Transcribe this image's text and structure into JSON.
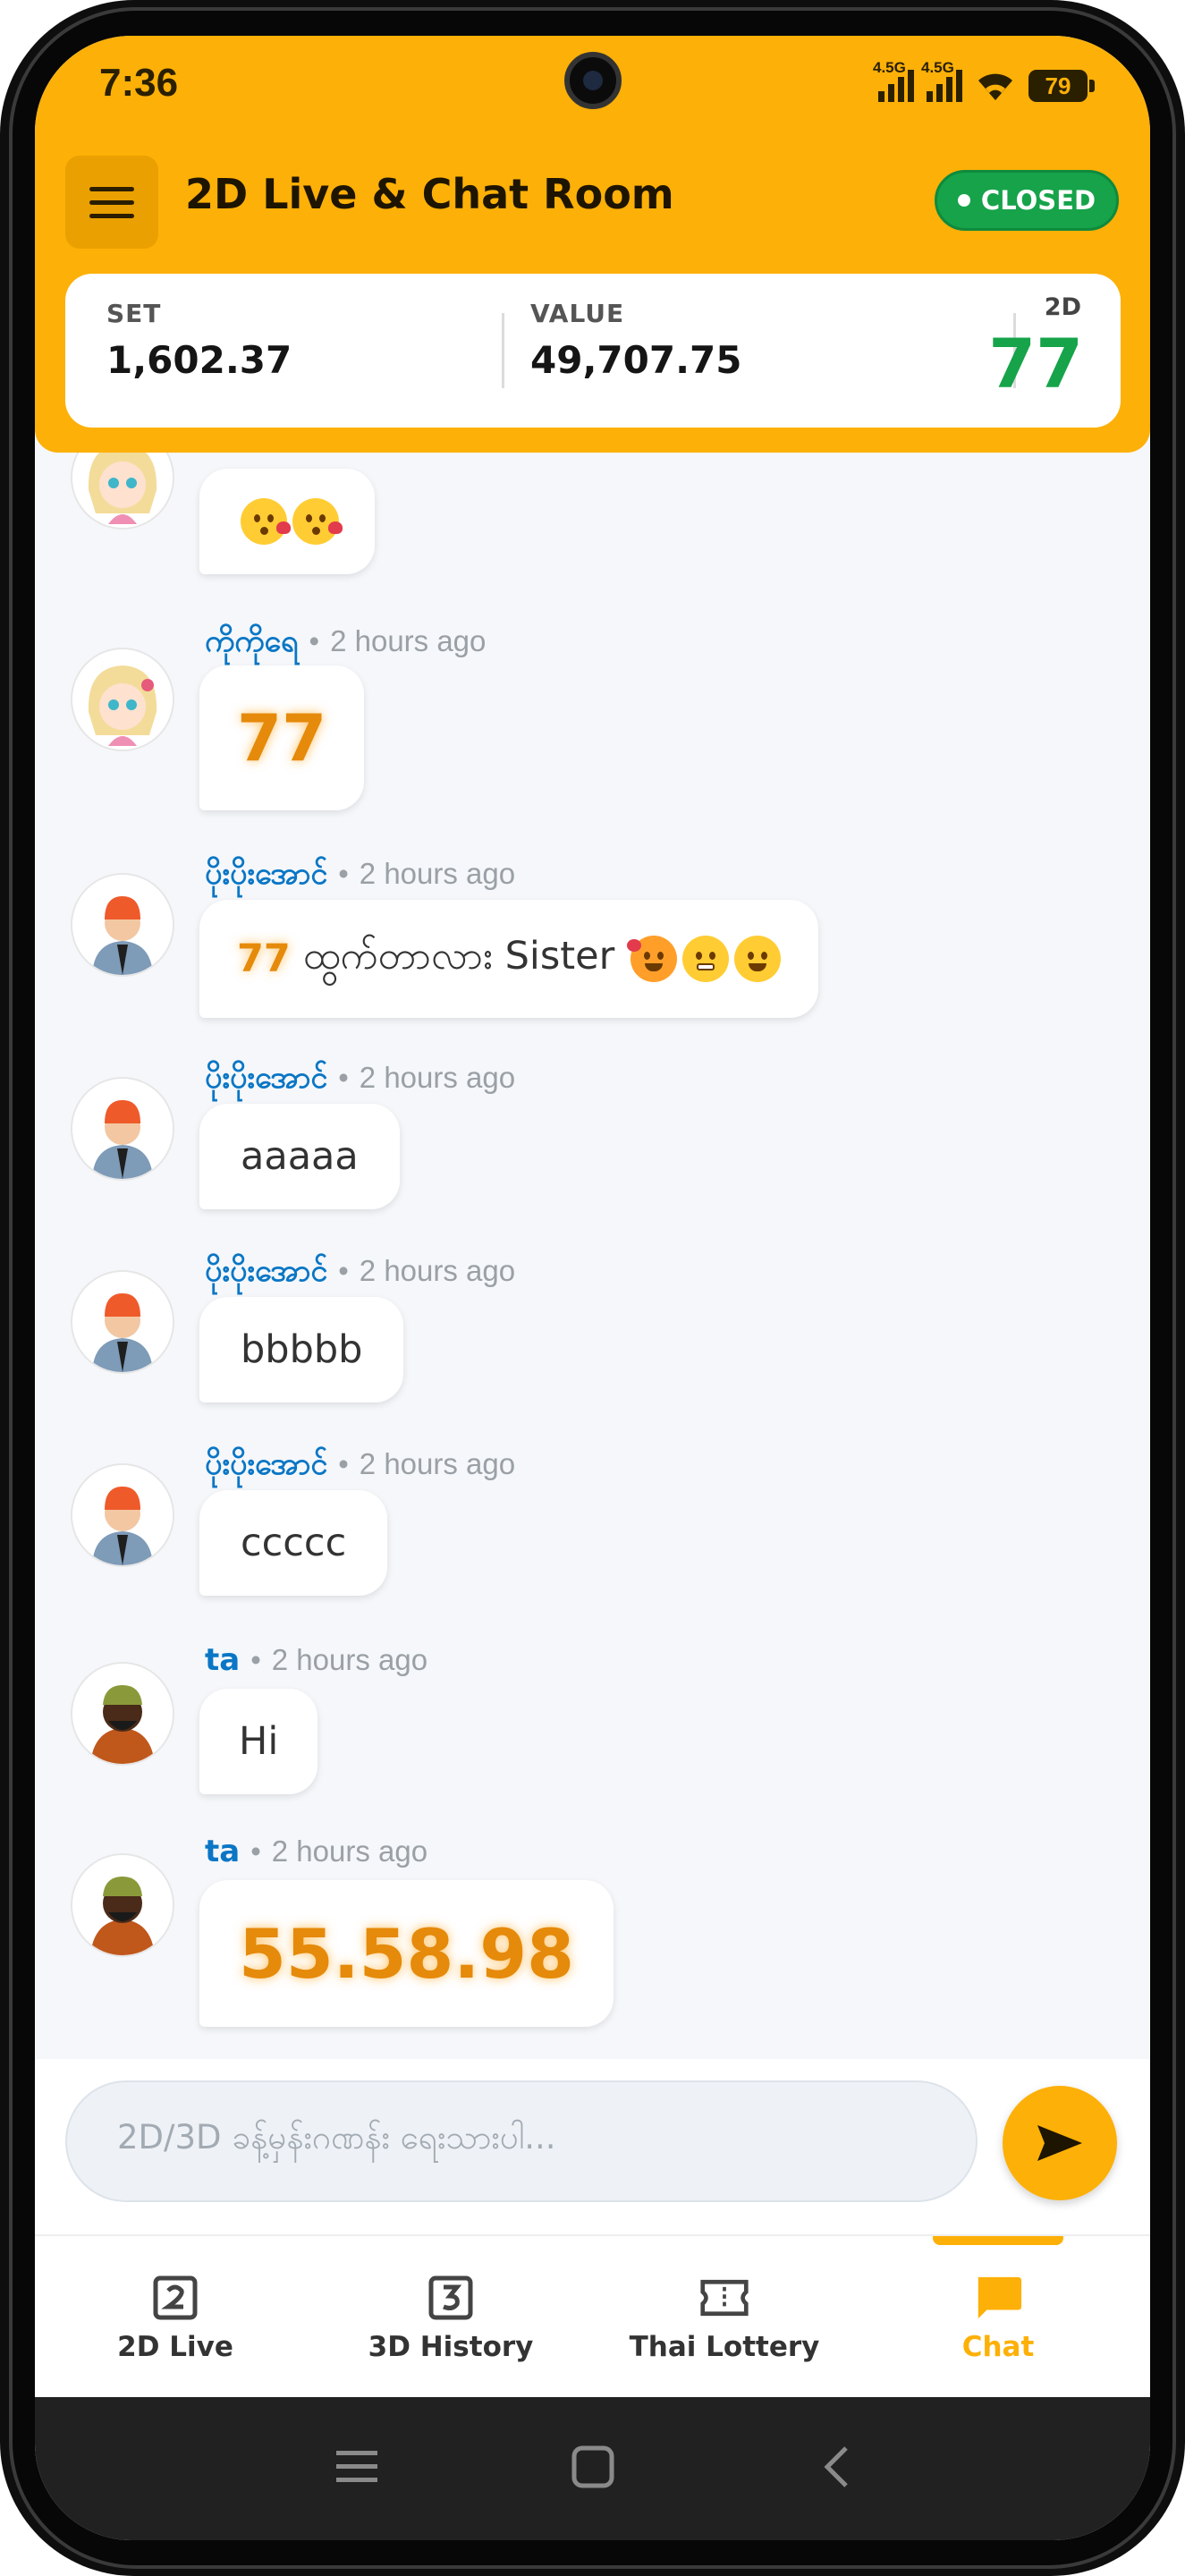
{
  "status_bar": {
    "time": "7:36",
    "network_1": "4.5G",
    "network_2": "4.5G",
    "battery": "79"
  },
  "header": {
    "title": "2D Live & Chat Room",
    "status_badge": "CLOSED",
    "set_label": "SET",
    "set_value": "1,602.37",
    "value_label": "VALUE",
    "value_value": "49,707.75",
    "twod_label": "2D",
    "twod_value": "77"
  },
  "messages": [
    {
      "user": "",
      "time": "",
      "text": "",
      "emoji": [
        "kiss-emoji",
        "kiss-emoji"
      ]
    },
    {
      "user": "ကိုကိုရေ",
      "time": "2 hours ago",
      "text": "77"
    },
    {
      "user": "ပိုးပိုးအောင်",
      "time": "2 hours ago",
      "number": "77",
      "text": "ထွက်တာလား Sister",
      "emoji": [
        "love-emoji",
        "grimace-emoji",
        "smile-emoji"
      ]
    },
    {
      "user": "ပိုးပိုးအောင်",
      "time": "2 hours ago",
      "text": "aaaaa"
    },
    {
      "user": "ပိုးပိုးအောင်",
      "time": "2 hours ago",
      "text": "bbbbb"
    },
    {
      "user": "ပိုးပိုးအောင်",
      "time": "2 hours ago",
      "text": "ccccc"
    },
    {
      "user": "ta",
      "time": "2 hours ago",
      "text": "Hi"
    },
    {
      "user": "ta",
      "time": "2 hours ago",
      "text": "55.58.98"
    }
  ],
  "separator": "•",
  "input": {
    "placeholder": "2D/3D ခန့်မှန်းဂဏန်း ရေးသားပါ..."
  },
  "nav": {
    "items": [
      {
        "label": "2D Live",
        "icon": "2d-icon"
      },
      {
        "label": "3D History",
        "icon": "3d-icon"
      },
      {
        "label": "Thai Lottery",
        "icon": "ticket-icon"
      },
      {
        "label": "Chat",
        "icon": "chat-icon"
      }
    ],
    "active": "Chat"
  },
  "colors": {
    "accent": "#fdb007",
    "closed": "#16a34a",
    "username": "#0a76c5",
    "number_highlight": "#e58a0a"
  }
}
